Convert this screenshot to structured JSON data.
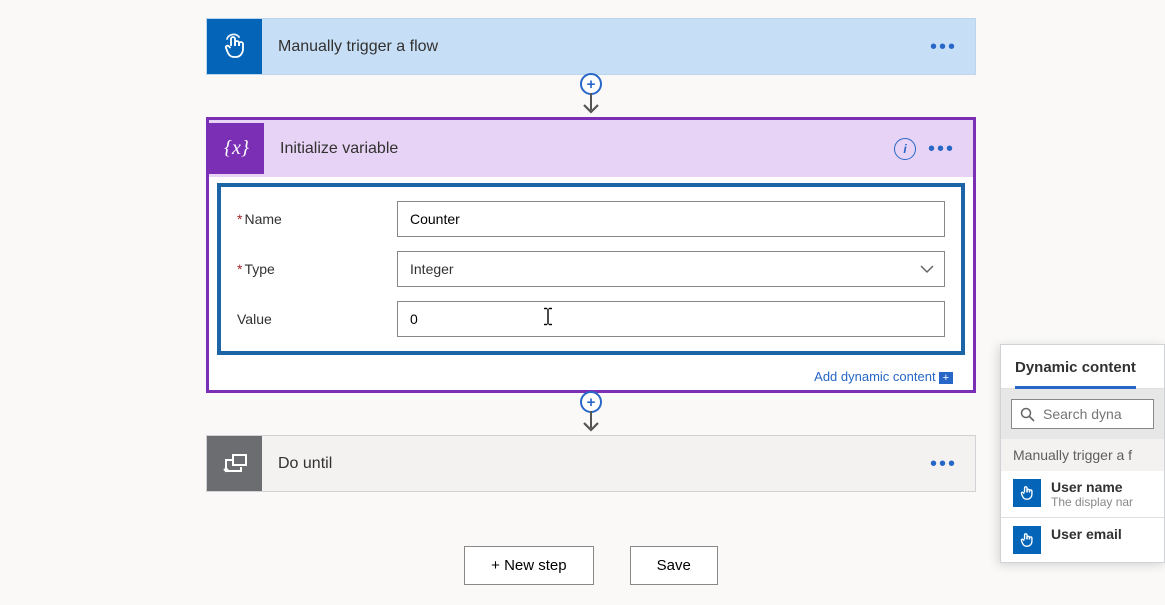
{
  "trigger": {
    "title": "Manually trigger a flow"
  },
  "initVar": {
    "title": "Initialize variable",
    "fields": {
      "name_label": "Name",
      "name_value": "Counter",
      "type_label": "Type",
      "type_value": "Integer",
      "value_label": "Value",
      "value_value": "0"
    },
    "add_dynamic_label": "Add dynamic content"
  },
  "doUntil": {
    "title": "Do until"
  },
  "buttons": {
    "new_step": "+ New step",
    "save": "Save"
  },
  "dynamicPanel": {
    "tab_label": "Dynamic content",
    "search_placeholder": "Search dyna",
    "section_header": "Manually trigger a f",
    "items": [
      {
        "title": "User name",
        "subtitle": "The display nar"
      },
      {
        "title": "User email",
        "subtitle": ""
      }
    ]
  }
}
